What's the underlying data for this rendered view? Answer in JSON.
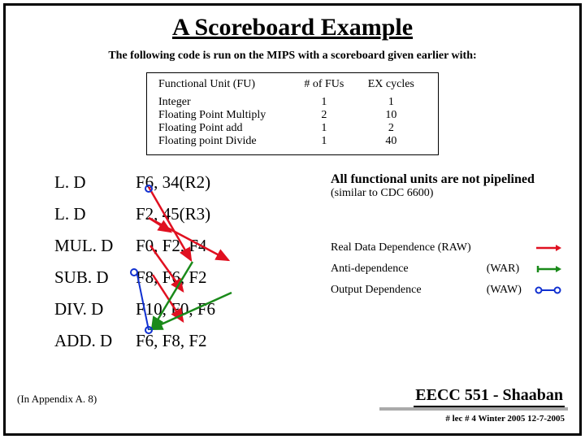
{
  "title": "A Scoreboard Example",
  "intro": "The following code is run on the MIPS with a scoreboard given earlier with:",
  "fu": {
    "hdr": {
      "c1": "Functional Unit (FU)",
      "c2": "# of  FUs",
      "c3": "EX cycles"
    },
    "rows": [
      {
        "c1": "Integer",
        "c2": "1",
        "c3": "1"
      },
      {
        "c1": "Floating Point Multiply",
        "c2": "2",
        "c3": "10"
      },
      {
        "c1": "Floating Point add",
        "c2": "1",
        "c3": "2"
      },
      {
        "c1": "Floating point Divide",
        "c2": "1",
        "c3": "40"
      }
    ]
  },
  "code": [
    {
      "op": "L. D",
      "args": "F6, 34(R2)"
    },
    {
      "op": "L. D",
      "args": "F2, 45(R3)"
    },
    {
      "op": "MUL. D",
      "args": "F0, F2, F4"
    },
    {
      "op": "SUB. D",
      "args": "F8, F6, F2"
    },
    {
      "op": "DIV. D",
      "args": "F10, F0, F6"
    },
    {
      "op": "ADD. D",
      "args": "F6, F8, F2"
    }
  ],
  "note1": "All functional units are not pipelined",
  "note2": "(similar to CDC 6600)",
  "deps": [
    {
      "label": "Real Data Dependence (RAW)",
      "type": ""
    },
    {
      "label": "Anti-dependence",
      "type": "(WAR)"
    },
    {
      "label": "Output Dependence",
      "type": "(WAW)"
    }
  ],
  "colors": {
    "raw": "#e01020",
    "war": "#1a8a1a",
    "waw": "#1030d0"
  },
  "footer": {
    "course": "EECC 551 - Shaaban",
    "lec": "#  lec # 4  Winter 2005    12-7-2005"
  },
  "appendix": "(In  Appendix A. 8)"
}
